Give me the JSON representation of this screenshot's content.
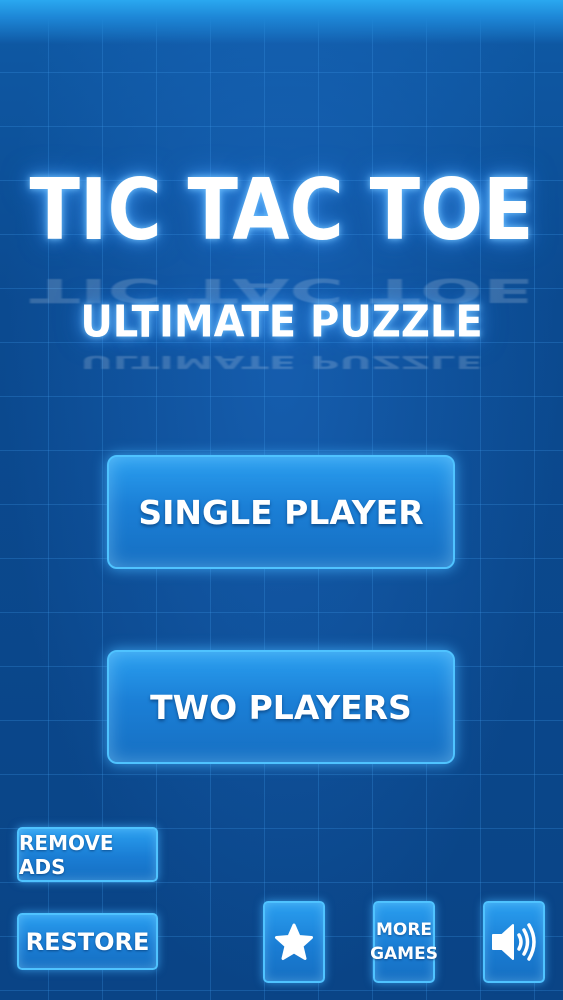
{
  "title": {
    "main": "TIC TAC TOE",
    "sub": "ULTIMATE PUZZLE"
  },
  "menu": {
    "single_player": "SINGLE PLAYER",
    "two_players": "TWO PLAYERS"
  },
  "bottom_bar": {
    "remove_ads": "REMOVE ADS",
    "restore": "RESTORE",
    "more_games_line1": "MORE",
    "more_games_line2": "GAMES",
    "rate_icon": "star-icon",
    "sound_icon": "speaker-icon"
  },
  "colors": {
    "background": "#0c4d92",
    "button_fill": "#1b7fd6",
    "button_border": "#4fc3ff",
    "text": "#ffffff"
  }
}
